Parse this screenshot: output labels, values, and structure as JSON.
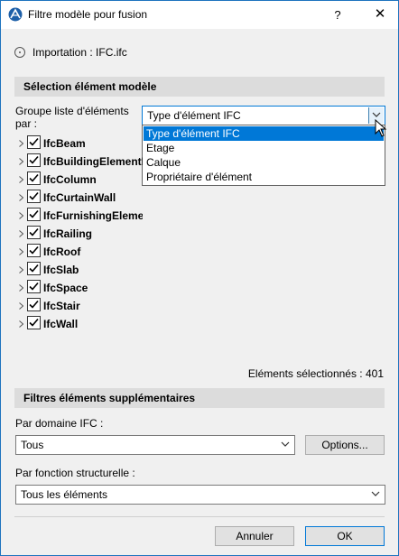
{
  "window": {
    "title": "Filtre modèle pour fusion",
    "help_label": "?",
    "close_label": "✕"
  },
  "import": {
    "label": "Importation : IFC.ifc"
  },
  "selection_section": {
    "title": "Sélection élément modèle"
  },
  "group_by": {
    "label": "Groupe liste d'éléments par :",
    "value": "Type d'élément IFC",
    "options": [
      "Type d'élément IFC",
      "Etage",
      "Calque",
      "Propriétaire d'élément"
    ],
    "selected_index": 0
  },
  "tree": {
    "items": [
      {
        "label": "IfcBeam",
        "checked": true
      },
      {
        "label": "IfcBuildingElementProxy",
        "checked": true
      },
      {
        "label": "IfcColumn",
        "checked": true
      },
      {
        "label": "IfcCurtainWall",
        "checked": true
      },
      {
        "label": "IfcFurnishingElement",
        "checked": true
      },
      {
        "label": "IfcRailing",
        "checked": true
      },
      {
        "label": "IfcRoof",
        "checked": true
      },
      {
        "label": "IfcSlab",
        "checked": true
      },
      {
        "label": "IfcSpace",
        "checked": true
      },
      {
        "label": "IfcStair",
        "checked": true
      },
      {
        "label": "IfcWall",
        "checked": true
      }
    ]
  },
  "selected_count": {
    "label": "Eléments sélectionnés : 401"
  },
  "extra_section": {
    "title": "Filtres éléments supplémentaires"
  },
  "ifc_domain": {
    "label": "Par domaine IFC :",
    "value": "Tous",
    "options_button": "Options..."
  },
  "structural": {
    "label": "Par fonction structurelle :",
    "value": "Tous les éléments"
  },
  "footer": {
    "cancel_label": "Annuler",
    "ok_label": "OK"
  },
  "colors": {
    "accent": "#0078d7",
    "section_bg": "#dcdcdc",
    "dialog_bg": "#f0f0f0"
  }
}
